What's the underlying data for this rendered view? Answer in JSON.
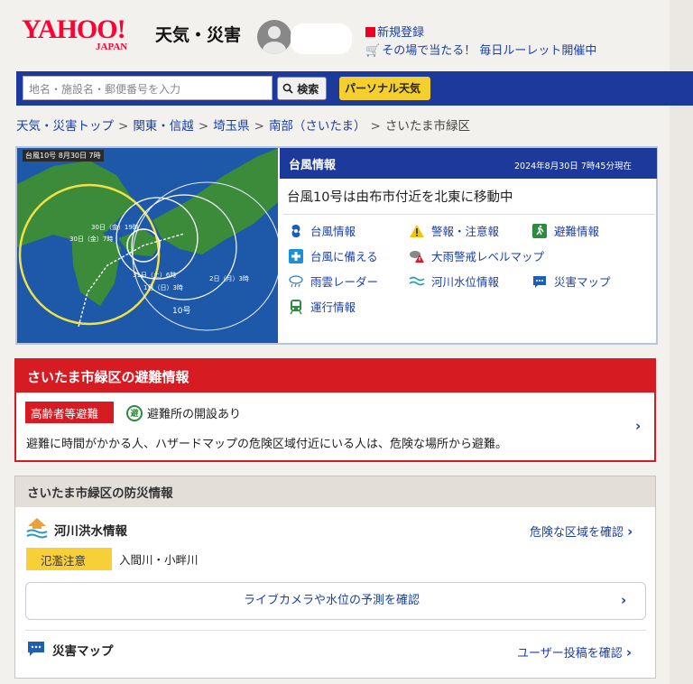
{
  "header": {
    "logo_main": "YAHOO!",
    "logo_sub": "JAPAN",
    "site_name": "天気・災害",
    "register_link": "新規登録",
    "promo_link": "その場で当たる！ 毎日ルーレット開催中"
  },
  "search": {
    "placeholder": "地名・施設名・郵便番号を入力",
    "button_label": "検索",
    "personal_button": "パーソナル天気"
  },
  "breadcrumb": {
    "items": [
      "天気・災害トップ",
      "関東・信越",
      "埼玉県",
      "南部（さいたま）"
    ],
    "current": "さいたま市緑区",
    "separator": ">"
  },
  "typhoon": {
    "map_tag": "台風10号",
    "map_tag_date": "8月30日 7時",
    "map_labels": {
      "l1": "30日（金）19時",
      "l2": "30日（金）7時",
      "l3": "31日（土）6時",
      "l4": "1日（日）3時",
      "l5": "2日（月）3時",
      "number": "10号"
    },
    "title": "台風情報",
    "timestamp": "2024年8月30日 7時45分現在",
    "headline": "台風10号は由布市付近を北東に移動中",
    "links": [
      {
        "label": "台風情報",
        "icon": "typhoon-icon"
      },
      {
        "label": "警報・注意報",
        "icon": "warning-icon"
      },
      {
        "label": "避難情報",
        "icon": "evacuation-icon"
      },
      {
        "label": "台風に備える",
        "icon": "prepare-icon"
      },
      {
        "label": "大雨警戒レベルマップ",
        "icon": "rain-alert-icon"
      },
      {
        "label": "災害マップ",
        "icon": "chat-icon"
      },
      {
        "label": "雨雲レーダー",
        "icon": "rain-cloud-icon"
      },
      {
        "label": "河川水位情報",
        "icon": "river-icon"
      },
      {
        "label": "運行情報",
        "icon": "train-icon"
      }
    ]
  },
  "evacuation": {
    "title": "さいたま市緑区の避難情報",
    "badge": "高齢者等避難",
    "shelter_icon_text": "避",
    "shelter_text": "避難所の開設あり",
    "message": "避難に時間がかかる人、ハザードマップの危険区域付近にいる人は、危険な場所から避難。"
  },
  "bosai": {
    "title": "さいたま市緑区の防災情報",
    "river_title": "河川洪水情報",
    "river_link": "危険な区域を確認",
    "flood_badge": "氾濫注意",
    "rivers": "入間川・小畔川",
    "live_button": "ライブカメラや水位の予測を確認",
    "map_title": "災害マップ",
    "user_link": "ユーザー投稿を確認"
  },
  "colors": {
    "navy": "#1c3a9c",
    "red": "#d71b23",
    "yellow": "#f5cf2d",
    "link": "#1a3fa8"
  }
}
